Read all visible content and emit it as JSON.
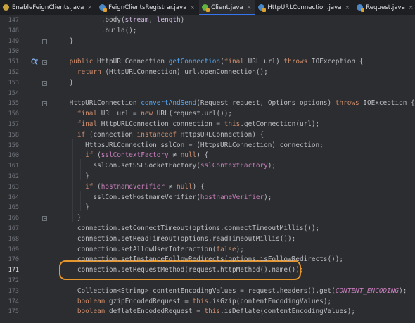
{
  "tabs": [
    {
      "label": "EnableFeignClients.java",
      "icon": "annotation-icon",
      "active": false
    },
    {
      "label": "FeignClientsRegistrar.java",
      "icon": "class-icon",
      "active": false
    },
    {
      "label": "Client.java",
      "icon": "interface-icon",
      "active": true
    },
    {
      "label": "HttpURLConnection.java",
      "icon": "class-icon",
      "active": false
    },
    {
      "label": "Request.java",
      "icon": "class-icon",
      "active": false
    },
    {
      "label": "AsyncClient.java",
      "icon": "interface-icon",
      "active": false
    },
    {
      "label": "Ap",
      "icon": "class-icon",
      "active": false
    }
  ],
  "tab_close_glyph": "×",
  "editor": {
    "current_line": "171",
    "lines": [
      {
        "n": "147",
        "tokens": [
          [
            "",
            "            .body("
          ],
          [
            "param ul",
            "stream"
          ],
          [
            "",
            ", "
          ],
          [
            "param ul",
            "length"
          ],
          [
            "",
            ")"
          ]
        ]
      },
      {
        "n": "148",
        "tokens": [
          [
            "",
            "            .build();"
          ]
        ]
      },
      {
        "n": "149",
        "tokens": [
          [
            "",
            "    }"
          ]
        ]
      },
      {
        "n": "150",
        "tokens": []
      },
      {
        "n": "151",
        "tokens": [
          [
            "",
            "    "
          ],
          [
            "kw",
            "public "
          ],
          [
            "",
            "HttpURLConnection "
          ],
          [
            "fn",
            "getConnection"
          ],
          [
            "",
            "("
          ],
          [
            "kw",
            "final "
          ],
          [
            "",
            "URL url) "
          ],
          [
            "kw",
            "throws "
          ],
          [
            "",
            "IOException {"
          ]
        ]
      },
      {
        "n": "152",
        "tokens": [
          [
            "",
            "      "
          ],
          [
            "kw",
            "return "
          ],
          [
            "",
            "(HttpURLConnection) url.openConnection();"
          ]
        ]
      },
      {
        "n": "153",
        "tokens": [
          [
            "",
            "    }"
          ]
        ]
      },
      {
        "n": "154",
        "tokens": []
      },
      {
        "n": "155",
        "tokens": [
          [
            "",
            "    HttpURLConnection "
          ],
          [
            "fn",
            "convertAndSend"
          ],
          [
            "",
            "(Request request, Options options) "
          ],
          [
            "kw",
            "throws "
          ],
          [
            "",
            "IOException {"
          ]
        ]
      },
      {
        "n": "156",
        "tokens": [
          [
            "",
            "      "
          ],
          [
            "kw",
            "final "
          ],
          [
            "",
            "URL url = "
          ],
          [
            "kw",
            "new "
          ],
          [
            "",
            "URL(request.url());"
          ]
        ]
      },
      {
        "n": "157",
        "tokens": [
          [
            "",
            "      "
          ],
          [
            "kw",
            "final "
          ],
          [
            "",
            "HttpURLConnection connection = "
          ],
          [
            "kw",
            "this"
          ],
          [
            "",
            ".getConnection(url);"
          ]
        ]
      },
      {
        "n": "158",
        "tokens": [
          [
            "",
            "      "
          ],
          [
            "kw",
            "if "
          ],
          [
            "",
            "(connection "
          ],
          [
            "kw",
            "instanceof "
          ],
          [
            "",
            "HttpsURLConnection) {"
          ]
        ]
      },
      {
        "n": "159",
        "tokens": [
          [
            "",
            "        HttpsURLConnection sslCon = (HttpsURLConnection) connection;"
          ]
        ]
      },
      {
        "n": "160",
        "tokens": [
          [
            "",
            "        "
          ],
          [
            "kw",
            "if "
          ],
          [
            "",
            "("
          ],
          [
            "field",
            "sslContextFactory"
          ],
          [
            "",
            " ≠ "
          ],
          [
            "kw",
            "null"
          ],
          [
            "",
            ") {"
          ]
        ]
      },
      {
        "n": "161",
        "tokens": [
          [
            "",
            "          sslCon.setSSLSocketFactory("
          ],
          [
            "field",
            "sslContextFactory"
          ],
          [
            "",
            ");"
          ]
        ]
      },
      {
        "n": "162",
        "tokens": [
          [
            "",
            "        }"
          ]
        ]
      },
      {
        "n": "163",
        "tokens": [
          [
            "",
            "        "
          ],
          [
            "kw",
            "if "
          ],
          [
            "",
            "("
          ],
          [
            "field",
            "hostnameVerifier"
          ],
          [
            "",
            " ≠ "
          ],
          [
            "kw",
            "null"
          ],
          [
            "",
            ") {"
          ]
        ]
      },
      {
        "n": "164",
        "tokens": [
          [
            "",
            "          sslCon.setHostnameVerifier("
          ],
          [
            "field",
            "hostnameVerifier"
          ],
          [
            "",
            ");"
          ]
        ]
      },
      {
        "n": "165",
        "tokens": [
          [
            "",
            "        }"
          ]
        ]
      },
      {
        "n": "166",
        "tokens": [
          [
            "",
            "      }"
          ]
        ]
      },
      {
        "n": "167",
        "tokens": [
          [
            "",
            "      connection.setConnectTimeout(options.connectTimeoutMillis());"
          ]
        ]
      },
      {
        "n": "168",
        "tokens": [
          [
            "",
            "      connection.setReadTimeout(options.readTimeoutMillis());"
          ]
        ]
      },
      {
        "n": "169",
        "tokens": [
          [
            "",
            "      connection.setAllowUserInteraction("
          ],
          [
            "kw",
            "false"
          ],
          [
            "",
            ");"
          ]
        ]
      },
      {
        "n": "170",
        "tokens": [
          [
            "",
            "      connection.setInstanceFollowRedirects(options.isFollowRedirects());"
          ]
        ]
      },
      {
        "n": "171",
        "tokens": [
          [
            "",
            "      connection.setRequestMethod(request.httpMethod().name());"
          ]
        ]
      },
      {
        "n": "172",
        "tokens": []
      },
      {
        "n": "173",
        "tokens": [
          [
            "",
            "      Collection<String> contentEncodingValues = request.headers().get("
          ],
          [
            "const",
            "CONTENT_ENCODING"
          ],
          [
            "",
            ");"
          ]
        ]
      },
      {
        "n": "174",
        "tokens": [
          [
            "",
            "      "
          ],
          [
            "kw",
            "boolean "
          ],
          [
            "",
            "gzipEncodedRequest = "
          ],
          [
            "kw",
            "this"
          ],
          [
            "",
            ".isGzip(contentEncodingValues);"
          ]
        ]
      },
      {
        "n": "175",
        "tokens": [
          [
            "",
            "      "
          ],
          [
            "kw",
            "boolean "
          ],
          [
            "",
            "deflateEncodedRequest = "
          ],
          [
            "kw",
            "this"
          ],
          [
            "",
            ".isDeflate(contentEncodingValues);"
          ]
        ]
      }
    ]
  },
  "highlight_color": "#e7962b"
}
